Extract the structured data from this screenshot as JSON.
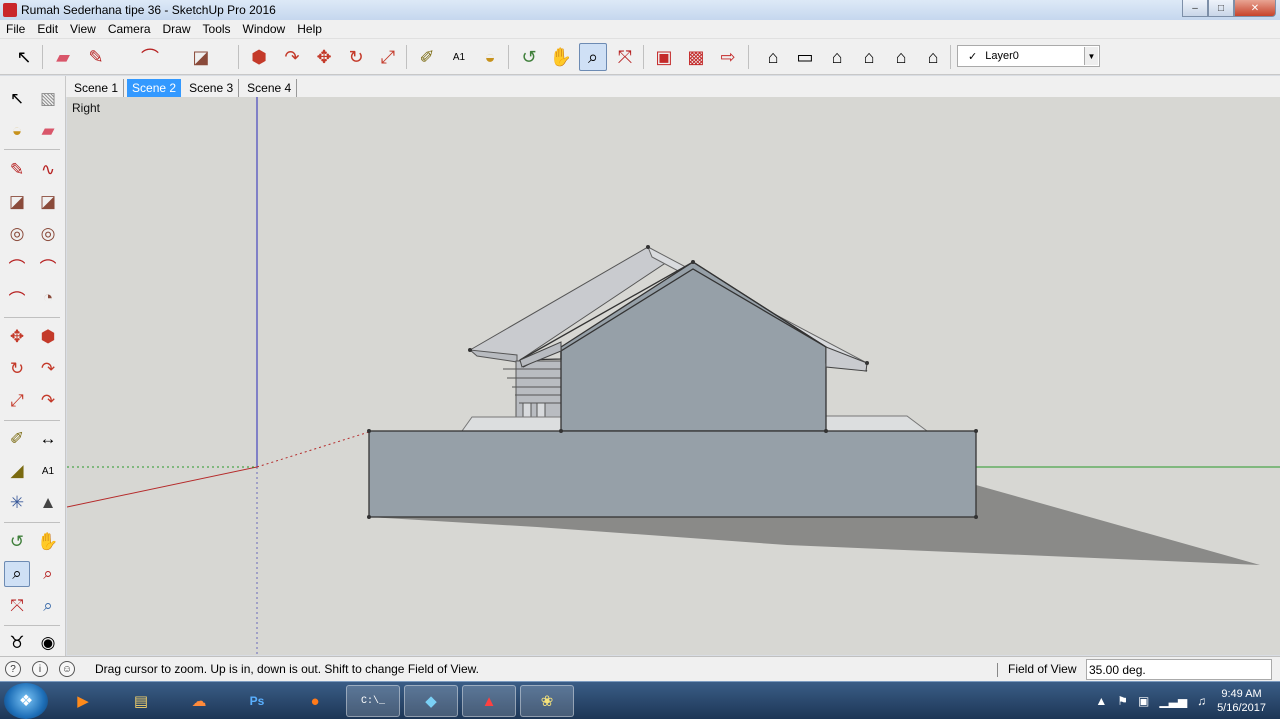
{
  "window": {
    "title": "Rumah Sederhana tipe 36 - SketchUp Pro 2016",
    "minimize": "–",
    "maximize": "□",
    "close": "✕"
  },
  "menu": [
    "File",
    "Edit",
    "View",
    "Camera",
    "Draw",
    "Tools",
    "Window",
    "Help"
  ],
  "toolbar": {
    "tools": [
      {
        "name": "select-tool",
        "icon": "↖"
      },
      {
        "name": "eraser-tool",
        "icon": "▰"
      },
      {
        "name": "line-tool",
        "icon": "✎"
      },
      {
        "name": "arc-tool",
        "icon": "⌒"
      },
      {
        "name": "rectangle-tool",
        "icon": "◪"
      },
      {
        "name": "push-pull-tool",
        "icon": "⬢"
      },
      {
        "name": "follow-me-tool",
        "icon": "↷"
      },
      {
        "name": "move-tool",
        "icon": "✥"
      },
      {
        "name": "rotate-tool",
        "icon": "↻"
      },
      {
        "name": "scale-tool",
        "icon": "⤢"
      },
      {
        "name": "tape-measure-tool",
        "icon": "✐"
      },
      {
        "name": "text-tool",
        "icon": "A1"
      },
      {
        "name": "paint-bucket-tool",
        "icon": "◒"
      },
      {
        "name": "orbit-tool",
        "icon": "↺"
      },
      {
        "name": "pan-tool",
        "icon": "✋"
      },
      {
        "name": "zoom-tool",
        "icon": "⌕"
      },
      {
        "name": "zoom-extents-tool",
        "icon": "⤧"
      },
      {
        "name": "warehouse-tool",
        "icon": "▣"
      },
      {
        "name": "extension-warehouse-tool",
        "icon": "▩"
      },
      {
        "name": "share-model-tool",
        "icon": "⇨"
      },
      {
        "name": "iso-view",
        "icon": "⌂"
      },
      {
        "name": "top-view",
        "icon": "▭"
      },
      {
        "name": "front-view",
        "icon": "⌂"
      },
      {
        "name": "right-view",
        "icon": "⌂"
      },
      {
        "name": "back-view",
        "icon": "⌂"
      },
      {
        "name": "left-view",
        "icon": "⌂"
      }
    ],
    "active_tool": "zoom-tool",
    "layer": {
      "check": "✓",
      "name": "Layer0",
      "dropdown": "▼"
    }
  },
  "left_tools": [
    "↖",
    "▧",
    "◒",
    "▰",
    "✎",
    "∿",
    "◪",
    "◪",
    "◎",
    "◎",
    "⌒",
    "⌒",
    "⌒",
    "◔",
    "✥",
    "⬢",
    "↻",
    "↷",
    "⤢",
    "↷",
    "✐",
    "↔",
    "◢",
    "A1",
    "✳",
    "▲",
    "↺",
    "✋",
    "⌕",
    "⌕",
    "⤧",
    "⌕",
    "♉",
    "◉"
  ],
  "scenes": [
    "Scene 1",
    "Scene 2",
    "Scene 3",
    "Scene 4"
  ],
  "active_scene": "Scene 2",
  "viewport": {
    "view_name": "Right"
  },
  "status": {
    "hint": "Drag cursor to zoom.  Up is in, down is out. Shift to change Field of View.",
    "vcb_label": "Field of View",
    "vcb_value": "35.00 deg.",
    "icons": [
      "?",
      "i",
      "☺"
    ]
  },
  "taskbar": {
    "apps": [
      "▶",
      "▤",
      "☁",
      "Ps",
      "●",
      "C:\\_",
      "◆",
      "▲",
      "❀"
    ],
    "tray_icons": [
      "▲",
      "⚑",
      "▣",
      "▁▃▅",
      "♫"
    ],
    "time": "9:49 AM",
    "date": "5/16/2017"
  }
}
